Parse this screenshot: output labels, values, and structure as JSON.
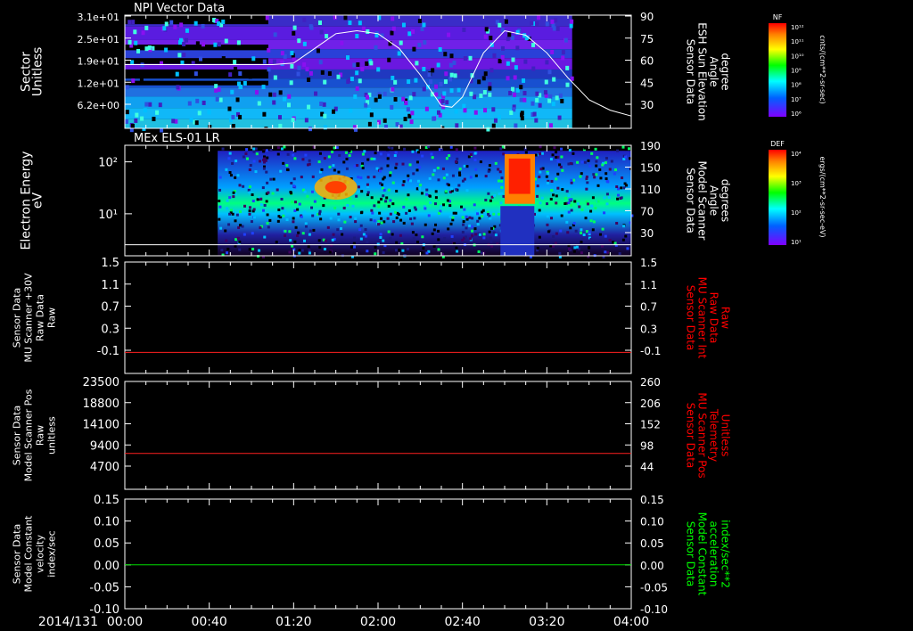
{
  "window": {
    "background": "#000000",
    "axis_color": "#ffffff"
  },
  "chart_data": [
    {
      "type": "heatmap",
      "title": "NPI Vector Data",
      "ylabel": [
        "Sector",
        "Unitless"
      ],
      "yticks": [
        "3.1e+01",
        "2.5e+01",
        "1.9e+01",
        "1.2e+01",
        "6.2e+00"
      ],
      "y2label": [
        "Sensor Data",
        "ESH Sun Elevation",
        "Angle",
        "degree"
      ],
      "y2label_color": "#ffffff",
      "y2ticks": [
        "90",
        "75",
        "60",
        "45",
        "30"
      ],
      "y2lim": [
        20,
        90
      ],
      "line": {
        "name": "ESH Sun Elevation Angle",
        "color": "#ffffff",
        "x": [
          0,
          70,
          80,
          90,
          100,
          110,
          120,
          130,
          140,
          150,
          155,
          160,
          170,
          180,
          190,
          200,
          210,
          220,
          230,
          240
        ],
        "y": [
          57,
          57,
          58,
          68,
          78,
          80,
          78,
          68,
          50,
          29,
          28,
          35,
          65,
          80,
          77,
          65,
          48,
          33,
          26,
          22
        ]
      },
      "colorbar": {
        "label": "cnts/(cm**2-sr-sec)",
        "tag": "NF",
        "ticks": [
          "10¹²",
          "10¹¹",
          "10¹⁰",
          "10⁹",
          "10⁸",
          "10⁷",
          "10⁶"
        ]
      }
    },
    {
      "type": "heatmap",
      "title": "MEx ELS-01 LR",
      "ylabel": [
        "Electron Energy",
        "eV"
      ],
      "yticks": [
        "10²",
        "10¹"
      ],
      "y2label": [
        "Sensor Data",
        "Model Scanner",
        "Angle",
        "degrees"
      ],
      "y2label_color": "#ffffff",
      "y2ticks": [
        "190",
        "150",
        "110",
        "70",
        "30"
      ],
      "line": {
        "name": "Model Scanner Angle",
        "color": "#ffffff",
        "x": [
          0,
          240
        ],
        "y": [
          5,
          5
        ]
      },
      "colorbar": {
        "label": "ergs/(cm**2-sr-sec-eV)",
        "tag": "DEF",
        "ticks": [
          "10⁴",
          "10³",
          "10²",
          "10¹"
        ]
      }
    },
    {
      "type": "line",
      "ylabel": [
        "Sensor Data",
        "MU Scanner +30V",
        "Raw Data",
        "Raw"
      ],
      "yticks": [
        "1.5",
        "1.1",
        "0.7",
        "0.3",
        "-0.1"
      ],
      "ylim": [
        -0.35,
        1.5
      ],
      "y2label": [
        "Sensor Data",
        "MU Scanner Int",
        "Raw Data",
        "Raw"
      ],
      "y2label_color": "#ff0000",
      "y2ticks": [
        "1.5",
        "1.1",
        "0.7",
        "0.3",
        "-0.1"
      ],
      "series": [
        {
          "color": "#ff2020",
          "x": [
            0,
            240
          ],
          "y": [
            0,
            0
          ]
        }
      ]
    },
    {
      "type": "line",
      "ylabel": [
        "Sensor Data",
        "Model Scanner Pos",
        "Raw",
        "unitless"
      ],
      "yticks": [
        "23500",
        "18800",
        "14100",
        "9400",
        "4700"
      ],
      "ylim": [
        0,
        23500
      ],
      "y2label": [
        "Sensor Data",
        "MU Scanner Pos",
        "Telemetry",
        "Unitless"
      ],
      "y2label_color": "#ff0000",
      "y2ticks": [
        "260",
        "206",
        "152",
        "98",
        "44"
      ],
      "series": [
        {
          "color": "#ff2020",
          "x": [
            0,
            240
          ],
          "y": [
            7800,
            7800
          ]
        }
      ]
    },
    {
      "type": "line",
      "ylabel": [
        "Sensor Data",
        "Model Constant",
        "velocity",
        "index/sec"
      ],
      "yticks": [
        "0.15",
        "0.10",
        "0.05",
        "0.00",
        "-0.05",
        "-0.10"
      ],
      "ylim": [
        -0.1,
        0.15
      ],
      "y2label": [
        "Sensor Data",
        "Model Constant",
        "acceleration",
        "index/sec**2"
      ],
      "y2label_color": "#00ff00",
      "y2ticks": [
        "0.15",
        "0.10",
        "0.05",
        "0.00",
        "-0.05",
        "-0.10"
      ],
      "series": [
        {
          "color": "#00dd00",
          "x": [
            0,
            240
          ],
          "y": [
            0,
            0
          ]
        }
      ]
    }
  ],
  "time_axis": {
    "date_label": "2014/131",
    "ticks": [
      "00:00",
      "00:40",
      "01:20",
      "02:00",
      "02:40",
      "03:20",
      "04:00"
    ],
    "range_minutes": [
      0,
      240
    ]
  }
}
